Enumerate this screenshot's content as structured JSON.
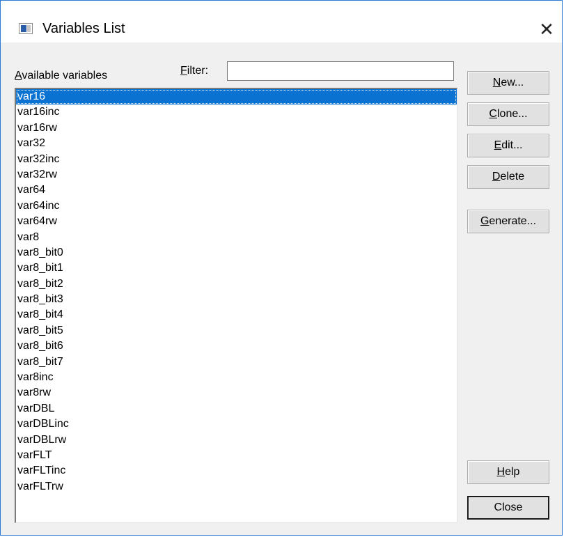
{
  "window": {
    "title": "Variables List",
    "close_glyph": "✕"
  },
  "labels": {
    "available_variables_prefix": "A",
    "available_variables_rest": "vailable variables",
    "filter_prefix": "F",
    "filter_rest": "ilter:"
  },
  "filter": {
    "value": "",
    "placeholder": ""
  },
  "list": {
    "selected_index": 0,
    "items": [
      "var16",
      "var16inc",
      "var16rw",
      "var32",
      "var32inc",
      "var32rw",
      "var64",
      "var64inc",
      "var64rw",
      "var8",
      "var8_bit0",
      "var8_bit1",
      "var8_bit2",
      "var8_bit3",
      "var8_bit4",
      "var8_bit5",
      "var8_bit6",
      "var8_bit7",
      "var8inc",
      "var8rw",
      "varDBL",
      "varDBLinc",
      "varDBLrw",
      "varFLT",
      "varFLTinc",
      "varFLTrw"
    ]
  },
  "buttons": {
    "new": {
      "mnemonic": "N",
      "rest": "ew..."
    },
    "clone": {
      "mnemonic": "C",
      "rest": "lone..."
    },
    "edit": {
      "mnemonic": "E",
      "rest": "dit..."
    },
    "delete": {
      "mnemonic": "D",
      "rest": "elete"
    },
    "generate": {
      "mnemonic": "G",
      "rest": "enerate..."
    },
    "help": {
      "mnemonic": "H",
      "rest": "elp"
    },
    "close": {
      "label": "Close"
    }
  },
  "colors": {
    "selection": "#0a73d2",
    "window_border": "#2b79d0",
    "dialog_bg": "#f0f0f0"
  }
}
